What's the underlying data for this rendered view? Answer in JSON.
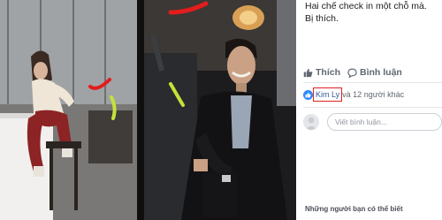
{
  "post": {
    "line1": "Hai chế check in một chỗ mà.",
    "line2": "Bị thích."
  },
  "actions": {
    "like_label": "Thích",
    "comment_label": "Bình luận"
  },
  "reactions": {
    "name": "Kim Ly",
    "others_text": "và 12 người khác"
  },
  "comment": {
    "placeholder": "Viết bình luận..."
  },
  "suggestions": {
    "heading": "Những người bạn có thể biết"
  },
  "colors": {
    "link": "#385898",
    "annotation_red": "#e02020",
    "annotation_yellow": "#c6e23a",
    "like_blue": "#2d88ff"
  },
  "icons": [
    "thumbs-up-icon",
    "comment-bubble-icon",
    "like-badge-icon",
    "avatar-icon"
  ]
}
